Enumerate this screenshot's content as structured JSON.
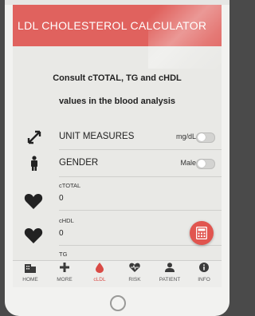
{
  "app": {
    "title": "LDL CHOLESTEROL CALCULATOR"
  },
  "intro": {
    "line1": "Consult cTOTAL, TG and cHDL",
    "line2": "values in the blood analysis"
  },
  "settings": [
    {
      "icon": "arrows-expand-icon",
      "label": "UNIT MEASURES",
      "value": "mg/dL",
      "toggle_on": false
    },
    {
      "icon": "person-icon",
      "label": "GENDER",
      "value": "Male",
      "toggle_on": false
    }
  ],
  "fields": [
    {
      "icon": "heart-icon",
      "label": "cTOTAL",
      "value": "0"
    },
    {
      "icon": "heart-icon",
      "label": "cHDL",
      "value": "0"
    },
    {
      "icon": "heart-icon",
      "label": "TG",
      "value": ""
    }
  ],
  "fab": {
    "icon": "calculator-icon"
  },
  "tabs": [
    {
      "icon": "building-icon",
      "label": "HOME",
      "active": false
    },
    {
      "icon": "plus-icon",
      "label": "MORE",
      "active": false
    },
    {
      "icon": "drop-icon",
      "label": "cLDL",
      "active": true
    },
    {
      "icon": "heartbeat-icon",
      "label": "RISK",
      "active": false
    },
    {
      "icon": "user-icon",
      "label": "PATIENT",
      "active": false
    },
    {
      "icon": "info-icon",
      "label": "INFO",
      "active": false
    }
  ],
  "colors": {
    "accent": "#e0625e",
    "active_tab": "#d94a45"
  }
}
